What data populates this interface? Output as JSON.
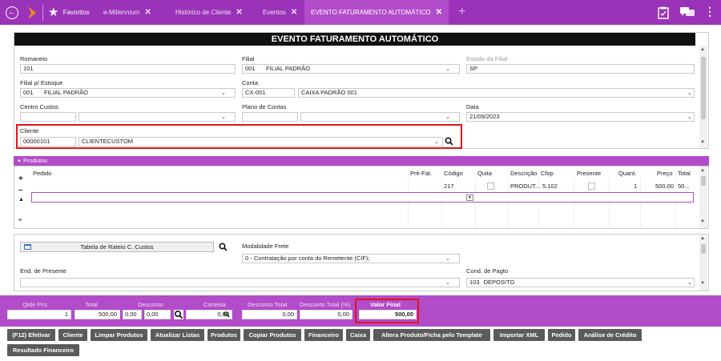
{
  "tabs": [
    {
      "label": "Favoritos"
    },
    {
      "label": "e-Millennium"
    },
    {
      "label": "Histórico de Cliente"
    },
    {
      "label": "Eventos"
    },
    {
      "label": "EVENTO FATURAMENTO AUTOMÁTICO"
    }
  ],
  "form": {
    "title": "EVENTO FATURAMENTO AUTOMÁTICO",
    "romaneio": {
      "label": "Romaneio",
      "value": "101"
    },
    "filial": {
      "label": "Filial",
      "code": "001",
      "name": "FILIAL PADRÃO"
    },
    "estado_filial": {
      "label": "Estado da Filial",
      "value": "SP"
    },
    "filial_estoque": {
      "label": "Filial p/ Estoque",
      "code": "001",
      "name": "FILIAL PADRÃO"
    },
    "conta": {
      "label": "Conta",
      "code": "CX-001",
      "name": "CAIXA PADRÃO 001"
    },
    "centro_custos": {
      "label": "Centro Custos",
      "code": "",
      "name": ""
    },
    "plano_contas": {
      "label": "Plano de Contas",
      "code": "",
      "name": ""
    },
    "data": {
      "label": "Data",
      "value": "21/09/2023"
    },
    "cliente": {
      "label": "Cliente",
      "code": "00000101",
      "name": "CLIENTECUSTOM"
    }
  },
  "produtos": {
    "header": "Produtos",
    "columns": [
      "Pedido",
      "Pré-Fat.",
      "Código",
      "Quita",
      "Descrição",
      "Cfop",
      "Presente",
      "Quant.",
      "Preço",
      "Total"
    ],
    "row": {
      "codigo": "217",
      "descricao": "PRODUT...",
      "cfop": "5.102",
      "quant": "1",
      "preco": "500,00",
      "total": "50..."
    }
  },
  "lower": {
    "tabela_rateio": "Tabela de Rateio C. Custos",
    "modalidade_frete": {
      "label": "Modalidade Frete",
      "value": "0 - Contratação por conta do Remetente (CIF);"
    },
    "end_presente": {
      "label": "End. de Presente",
      "value": ""
    },
    "cond_pagto": {
      "label": "Cond. de Pagto",
      "code": "103",
      "name": "DEPOSITO"
    }
  },
  "totals": {
    "qtde_pcs": {
      "label": "Qtde Pcs",
      "value": "1"
    },
    "total": {
      "label": "Total",
      "value": "500,00"
    },
    "desconto": {
      "label": "Desconto",
      "v1": "0,00",
      "v2": "0,00"
    },
    "cortesia": {
      "label": "Cortesia",
      "value": "0,00"
    },
    "desconto_total": {
      "label": "Desconto Total",
      "value": "0,00"
    },
    "desconto_total_pct": {
      "label": "Desconto Total (%)",
      "value": "0,00"
    },
    "valor_final": {
      "label": "Valor Final",
      "value": "500,00"
    }
  },
  "buttons": [
    "(F12) Efetivar",
    "Cliente",
    "Limpar Produtos",
    "Atualizar Listas",
    "Produtos",
    "Copiar Produtos",
    "Financeiro",
    "Caixa",
    "Altera Produto/Ficha pelo Template",
    "Importar XML",
    "Pedido",
    "Análise de Crédito",
    "Resultado Financeiro"
  ],
  "colors": {
    "brand": "#9b33b8",
    "accent": "#b24cc9",
    "highlight": "#e0141e",
    "button": "#5b5b5b"
  }
}
